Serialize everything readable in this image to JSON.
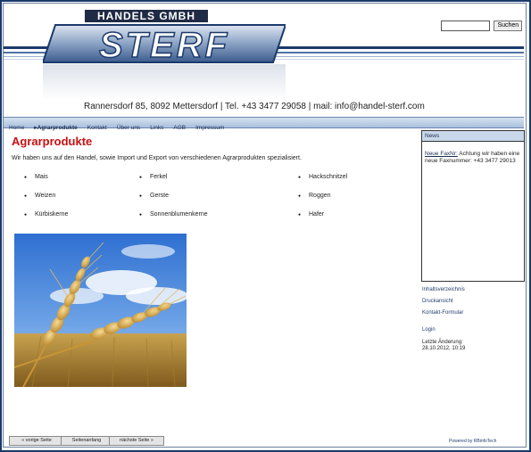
{
  "header": {
    "logo_top": "HANDELS GMBH",
    "logo_main": "STERF",
    "address": "Rannersdorf 85, 8092 Mettersdorf | Tel. +43 3477 29058 | mail: info@handel-sterf.com"
  },
  "search": {
    "placeholder": "",
    "button_label": "Suchen"
  },
  "nav": {
    "items": [
      "Home",
      "Agrarprodukte",
      "Kontakt",
      "Über uns",
      "Links",
      "AGB",
      "Impressum"
    ],
    "active_index": 1
  },
  "main": {
    "title": "Agrarprodukte",
    "intro": "Wir haben uns auf den Handel, sowie Import und Export von verschiedenen Agrarprodukten spezialisiert.",
    "products": {
      "col1": [
        "Mais",
        "Weizen",
        "Kürbiskerne"
      ],
      "col2": [
        "Ferkel",
        "Gerste",
        "Sonnenblumenkerne"
      ],
      "col3": [
        "Hackschnitzel",
        "Roggen",
        "Hafer"
      ]
    }
  },
  "sidebar": {
    "news_header": "News",
    "news_link": "Neue FaxNr:",
    "news_text": " Achtung wir haben eine neue Faxnummer: +43 3477 29013",
    "links": [
      "Inhaltsverzeichnis",
      "Druckansicht",
      "Kontakt-Formular"
    ],
    "login": "Login",
    "last_change_label": "Letzte Änderung:",
    "last_change_date": "28.10.2012, 10:19"
  },
  "footer": {
    "prev": "« vorige Seite",
    "start": "Seitenanfang",
    "next": "nächste Seite »",
    "powered": "Powered by RBinfoTech"
  },
  "colors": {
    "accent_red": "#c81010",
    "nav_blue": "#a9bfdc",
    "dark_blue": "#1b3a6b"
  }
}
